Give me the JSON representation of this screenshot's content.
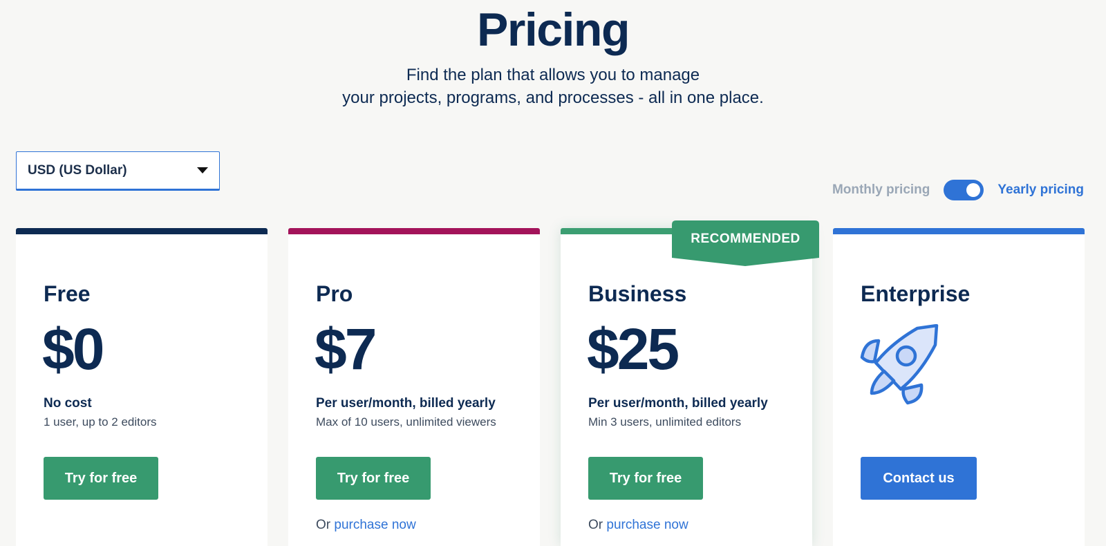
{
  "header": {
    "title": "Pricing",
    "subtitle_line1": "Find the plan that allows you to manage",
    "subtitle_line2": "your projects, programs, and processes - all in one place."
  },
  "currency": {
    "selected": "USD (US Dollar)"
  },
  "billing": {
    "monthly_label": "Monthly pricing",
    "yearly_label": "Yearly pricing",
    "yearly_selected": true
  },
  "badge": {
    "recommended": "RECOMMENDED"
  },
  "plans": [
    {
      "name": "Free",
      "price": "$0",
      "price_label": "No cost",
      "detail": "1 user, up to 2 editors",
      "cta": "Try for free",
      "accent": "#0d2a52"
    },
    {
      "name": "Pro",
      "price": "$7",
      "price_label": "Per user/month, billed yearly",
      "detail": "Max of 10 users, unlimited viewers",
      "cta": "Try for free",
      "or_text": "Or",
      "purchase_link": "purchase now",
      "accent": "#a3135a"
    },
    {
      "name": "Business",
      "price": "$25",
      "price_label": "Per user/month, billed yearly",
      "detail": "Min 3 users, unlimited editors",
      "cta": "Try for free",
      "or_text": "Or",
      "purchase_link": "purchase now",
      "accent": "#3c9e72"
    },
    {
      "name": "Enterprise",
      "icon": "rocket-icon",
      "cta": "Contact us",
      "accent": "#2f73d6"
    }
  ]
}
